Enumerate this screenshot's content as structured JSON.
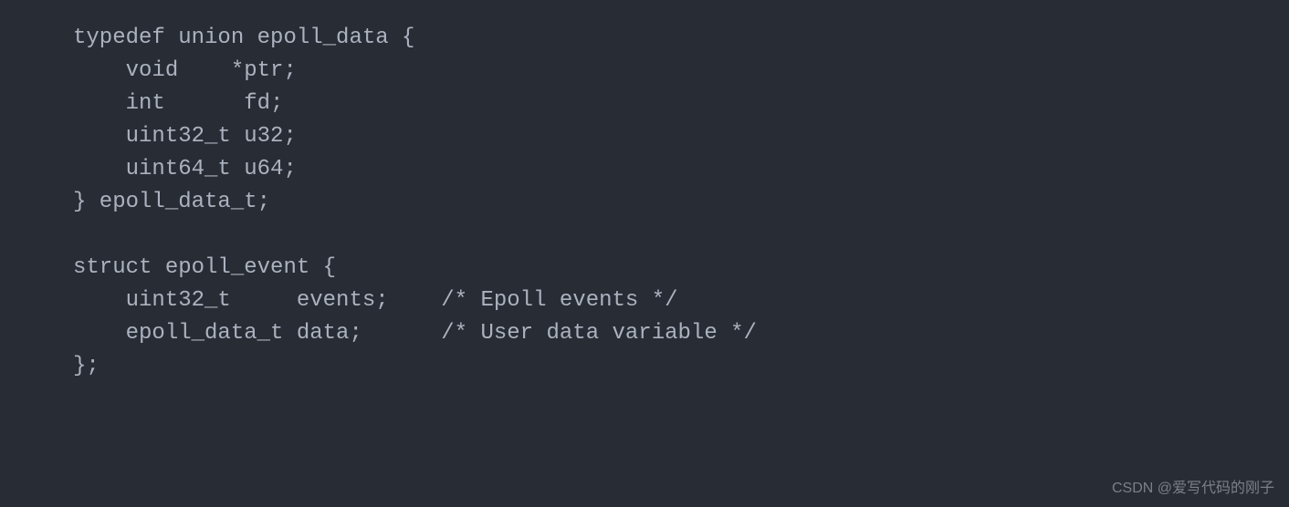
{
  "code": {
    "line1": "typedef union epoll_data {",
    "line2": "    void    *ptr;",
    "line3": "    int      fd;",
    "line4": "    uint32_t u32;",
    "line5": "    uint64_t u64;",
    "line6": "} epoll_data_t;",
    "line7": "",
    "line8": "struct epoll_event {",
    "line9": "    uint32_t     events;    /* Epoll events */",
    "line10": "    epoll_data_t data;      /* User data variable */",
    "line11": "};"
  },
  "watermark": "CSDN @爱写代码的刚子"
}
